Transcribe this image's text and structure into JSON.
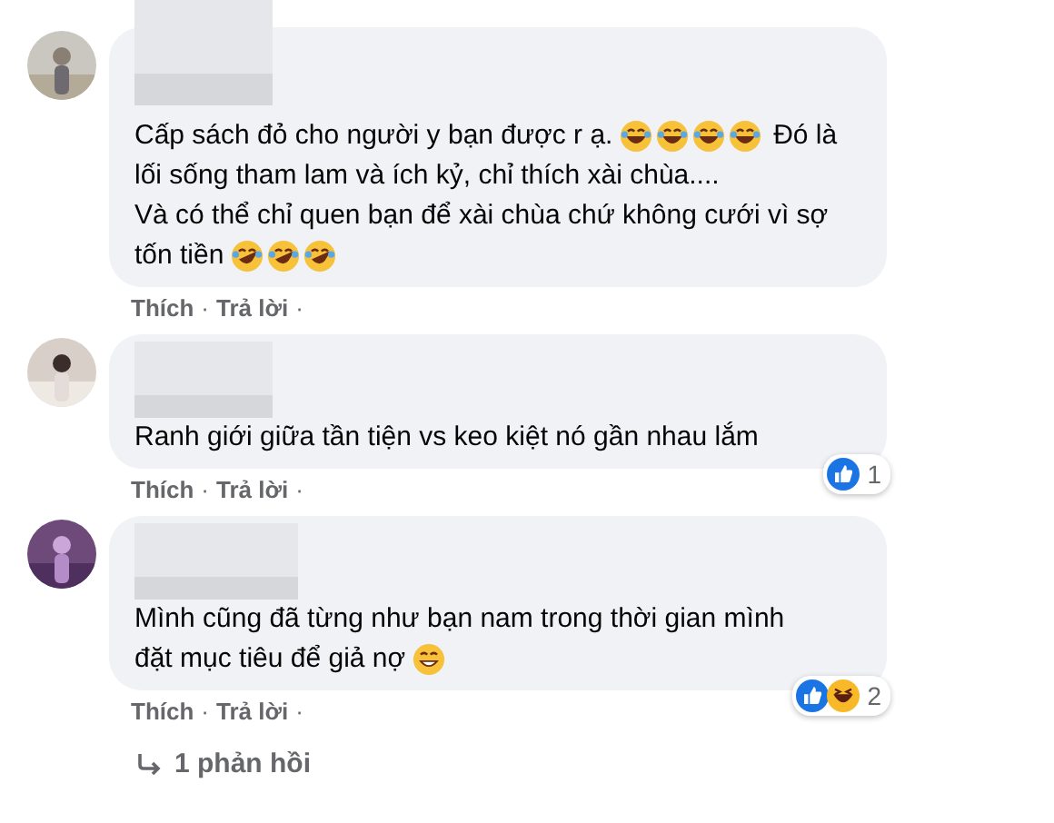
{
  "comments": [
    {
      "lines": [
        [
          {
            "kind": "text",
            "text": "Cấp sách đỏ cho người y bạn được r ạ. "
          },
          {
            "kind": "joy"
          },
          {
            "kind": "joy"
          },
          {
            "kind": "joy"
          },
          {
            "kind": "joy"
          },
          {
            "kind": "text",
            "text": " Đó là"
          }
        ],
        [
          {
            "kind": "text",
            "text": "lối sống tham lam và ích kỷ, chỉ thích xài chùa...."
          }
        ],
        [
          {
            "kind": "text",
            "text": "Và có thể chỉ quen bạn để xài chùa chứ không cưới vì sợ"
          }
        ],
        [
          {
            "kind": "text",
            "text": "tốn tiền "
          },
          {
            "kind": "rofl"
          },
          {
            "kind": "rofl"
          },
          {
            "kind": "rofl"
          }
        ]
      ],
      "actions": [
        "Thích",
        "·",
        "Trả lời",
        "·"
      ]
    },
    {
      "lines": [
        [
          {
            "kind": "text",
            "text": "Ranh giới giữa tần tiện vs keo kiệt nó gần nhau lắm"
          }
        ]
      ],
      "reactions": {
        "icons": [
          {
            "kind": "like"
          }
        ],
        "count": "1"
      },
      "actions": [
        "Thích",
        "·",
        "Trả lời",
        "·"
      ]
    },
    {
      "lines": [
        [
          {
            "kind": "text",
            "text": "Mình cũng đã từng như bạn nam trong thời gian mình"
          }
        ],
        [
          {
            "kind": "text",
            "text": "đặt mục tiêu để giả nợ "
          },
          {
            "kind": "sweat"
          }
        ]
      ],
      "reactions": {
        "icons": [
          {
            "kind": "like"
          },
          {
            "kind": "haha"
          }
        ],
        "count": "2"
      },
      "actions": [
        "Thích",
        "·",
        "Trả lời",
        "·"
      ],
      "replies": "1 phản hồi"
    }
  ]
}
